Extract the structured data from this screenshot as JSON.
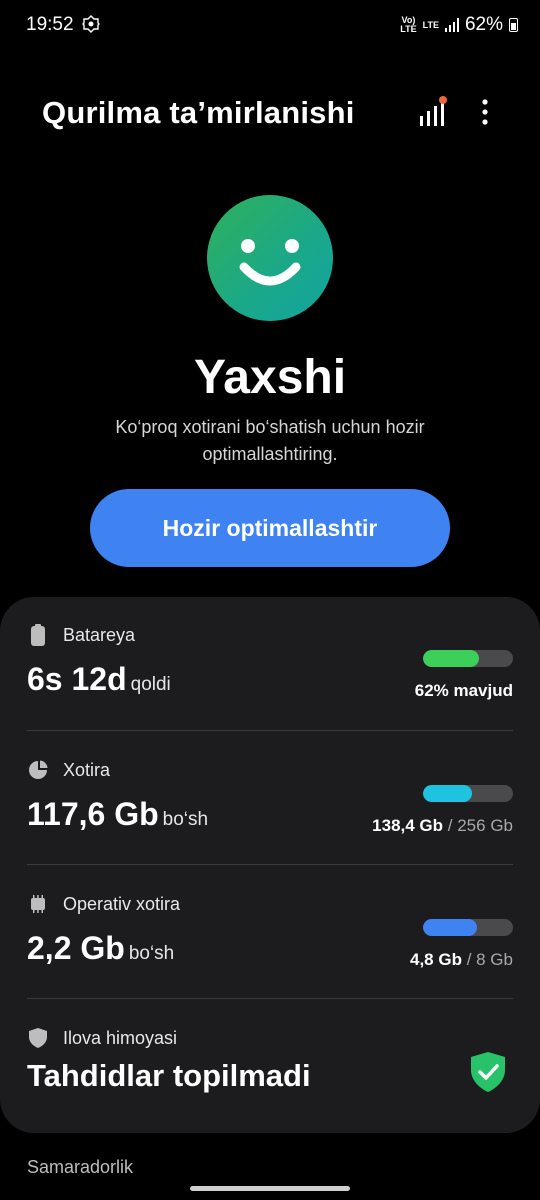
{
  "status_bar": {
    "time": "19:52",
    "volte": "Vo)\nLTE",
    "lte": "LTE",
    "battery_percent": "62%"
  },
  "header": {
    "title": "Qurilma ta’mirlanishi"
  },
  "hero": {
    "status": "Yaxshi",
    "description": "Ko‘proq xotirani bo‘shatish uchun hozir optimallashtiring.",
    "button_label": "Hozir optimallashtir"
  },
  "battery": {
    "label": "Batareya",
    "value": "6s 12d",
    "unit": "qoldi",
    "caption": "62% mavjud",
    "level": 0.62,
    "color": "#3ccf5a"
  },
  "storage": {
    "label": "Xotira",
    "value": "117,6 Gb",
    "unit": "bo‘sh",
    "used": "138,4 Gb",
    "total": "/ 256 Gb",
    "level": 0.54,
    "color": "#1ec3e0"
  },
  "ram": {
    "label": "Operativ xotira",
    "value": "2,2 Gb",
    "unit": "bo‘sh",
    "used": "4,8 Gb",
    "total": "/ 8 Gb",
    "level": 0.6,
    "color": "#3f82f2"
  },
  "app_protection": {
    "label": "Ilova himoyasi",
    "value": "Tahdidlar topilmadi"
  },
  "footer": {
    "section_label": "Samaradorlik"
  },
  "icons": [
    "gear-icon",
    "signal-icon",
    "battery-icon",
    "stats-icon",
    "more-options-icon",
    "smiley-icon",
    "storage-pie-icon",
    "chip-icon",
    "shield-icon",
    "shield-check-icon"
  ]
}
